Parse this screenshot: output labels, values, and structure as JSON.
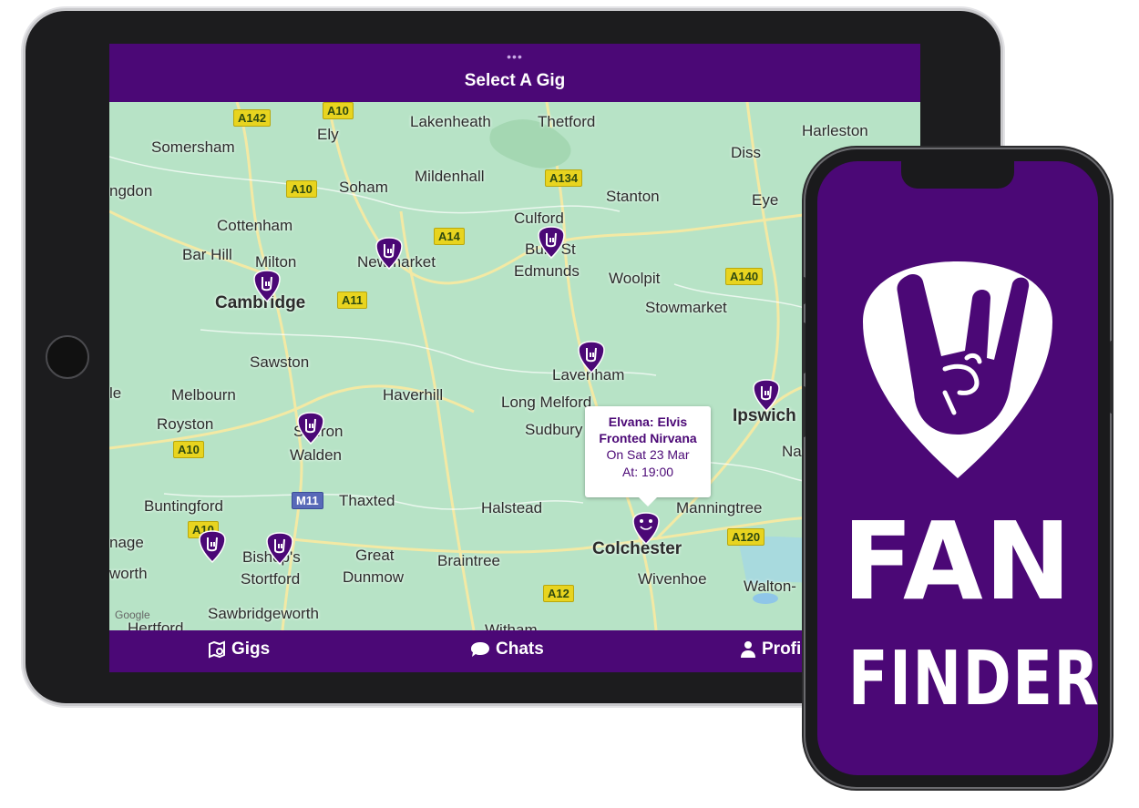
{
  "tablet": {
    "header": {
      "dots": "•••",
      "title": "Select A Gig"
    },
    "map": {
      "places": [
        {
          "name": "Lakenheath",
          "major": false
        },
        {
          "name": "Thetford",
          "major": false
        },
        {
          "name": "Harleston",
          "major": false
        },
        {
          "name": "Somersham",
          "major": false
        },
        {
          "name": "Ely",
          "major": false
        },
        {
          "name": "Diss",
          "major": false
        },
        {
          "name": "Mildenhall",
          "major": false
        },
        {
          "name": "ngdon",
          "major": false
        },
        {
          "name": "Soham",
          "major": false
        },
        {
          "name": "Stanton",
          "major": false
        },
        {
          "name": "Eye",
          "major": false
        },
        {
          "name": "Cottenham",
          "major": false
        },
        {
          "name": "Culford",
          "major": false
        },
        {
          "name": "Bar Hill",
          "major": false
        },
        {
          "name": "Milton",
          "major": false
        },
        {
          "name": "Newmarket",
          "major": false
        },
        {
          "name": "Bury St",
          "major": false
        },
        {
          "name": "Edmunds",
          "major": false
        },
        {
          "name": "Woolpit",
          "major": false
        },
        {
          "name": "Cambridge",
          "major": true
        },
        {
          "name": "Stowmarket",
          "major": false
        },
        {
          "name": "Sawston",
          "major": false
        },
        {
          "name": "Lavenham",
          "major": false
        },
        {
          "name": "le",
          "major": false
        },
        {
          "name": "Melbourn",
          "major": false
        },
        {
          "name": "Haverhill",
          "major": false
        },
        {
          "name": "Long Melford",
          "major": false
        },
        {
          "name": "Ipswich",
          "major": true
        },
        {
          "name": "Royston",
          "major": false
        },
        {
          "name": "Saffron",
          "major": false
        },
        {
          "name": "Walden",
          "major": false
        },
        {
          "name": "Sudbury",
          "major": false
        },
        {
          "name": "Nac",
          "major": false
        },
        {
          "name": "Buntingford",
          "major": false
        },
        {
          "name": "Thaxted",
          "major": false
        },
        {
          "name": "Halstead",
          "major": false
        },
        {
          "name": "Manningtree",
          "major": false
        },
        {
          "name": "nage",
          "major": false
        },
        {
          "name": "Bishop's",
          "major": false
        },
        {
          "name": "Great",
          "major": false
        },
        {
          "name": "Colchester",
          "major": true
        },
        {
          "name": "worth",
          "major": false
        },
        {
          "name": "Stortford",
          "major": false
        },
        {
          "name": "Dunmow",
          "major": false
        },
        {
          "name": "Braintree",
          "major": false
        },
        {
          "name": "Wivenhoe",
          "major": false
        },
        {
          "name": "Walton-",
          "major": false
        },
        {
          "name": "Sawbridgeworth",
          "major": false
        },
        {
          "name": "Hertford",
          "major": false
        },
        {
          "name": "Witham",
          "major": false
        }
      ],
      "road_shields": [
        "A142",
        "A10",
        "A10",
        "A134",
        "A14",
        "A140",
        "A11",
        "A10",
        "M11",
        "A10",
        "A120",
        "A12",
        "A140"
      ],
      "google_logo": "Google",
      "info_window": {
        "title": "Elvana: Elvis Fronted Nirvana",
        "date": "On Sat 23 Mar",
        "time": "At: 19:00"
      },
      "gig_pins": 9
    },
    "tabbar": {
      "gigs": "Gigs",
      "chats": "Chats",
      "profile": "Profi"
    }
  },
  "phone": {
    "brand_line1": "FAN",
    "brand_line2": "FINDER"
  },
  "colors": {
    "brand_purple": "#4b0876",
    "map_green": "#b7e3c6",
    "road_yellow": "#e8d41f"
  }
}
